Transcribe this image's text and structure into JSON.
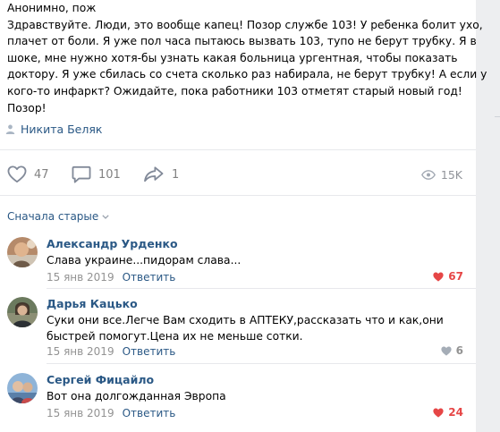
{
  "post": {
    "lines": [
      "Анонимно, пож",
      "Здравствуйте. Люди, это вообще капец! Позор службе 103! У ребенка болит ухо,",
      "плачет от боли. Я уже пол часа пытаюсь вызвать 103, тупо не берут трубку. Я в",
      "шоке, мне нужно хотя-бы узнать какая больница ургентная, чтобы показать",
      "доктору. Я уже сбилась со счета сколько раз набирала, не берут трубку! А если у",
      "кого-то инфаркт? Ожидайте, пока работники 103 отметят старый новый год!",
      "Позор!"
    ],
    "signature": "Никита Беляк"
  },
  "actions": {
    "likes": "47",
    "comments": "101",
    "shares": "1",
    "views": "15K"
  },
  "sort_label": "Сначала старые",
  "comments": [
    {
      "author": "Александр Урденко",
      "text": [
        "Слава украине...пидорам слава..."
      ],
      "date": "15 янв 2019",
      "reply": "Ответить",
      "likes": "67",
      "liked": true
    },
    {
      "author": "Дарья Кацько",
      "text": [
        "Суки они все.Легче Вам сходить в АПТЕКУ,рассказать что и как,они",
        "быстрей помогут.Цена их не меньше сотки."
      ],
      "date": "15 янв 2019",
      "reply": "Ответить",
      "likes": "6",
      "liked": false
    },
    {
      "author": "Сергей Фицайло",
      "text": [
        "Вот она долгожданная Эвропа"
      ],
      "date": "15 янв 2019",
      "reply": "Ответить",
      "likes": "24",
      "liked": true
    }
  ],
  "colors": {
    "link": "#2a5885",
    "like_active": "#e64646",
    "muted": "#939393",
    "separator": "#e7e8ec"
  }
}
